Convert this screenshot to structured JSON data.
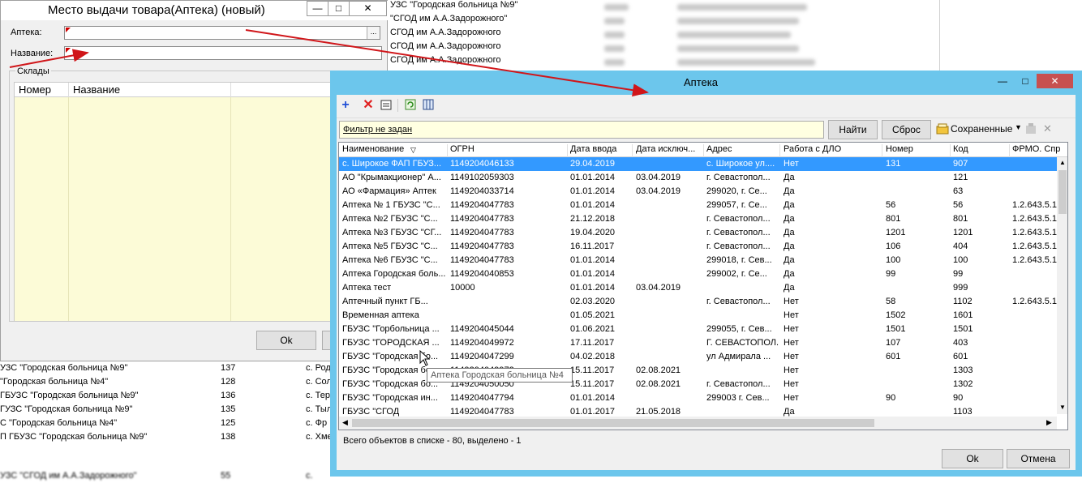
{
  "background_list_top": [
    {
      "name": "УЗС \"Городская больница №9\""
    },
    {
      "name": "\"СГОД им А.А.Задорожного\""
    },
    {
      "name": "СГОД им А.А.Задорожного"
    },
    {
      "name": "СГОД им А.А.Задорожного"
    },
    {
      "name": "СГОД им А.А.Задорожного"
    }
  ],
  "background_list_bottom": [
    {
      "name": "УЗС \"Городская больница №9\"",
      "num": "137",
      "addr": "с. Род"
    },
    {
      "name": "\"Городская больница №4\"",
      "num": "128",
      "addr": "с. Сол"
    },
    {
      "name": "ГБУЗС \"Городская больница №9\"",
      "num": "136",
      "addr": "с. Тер"
    },
    {
      "name": "ГУЗС \"Городская больница №9\"",
      "num": "135",
      "addr": "с. Тыл"
    },
    {
      "name": "С \"Городская больница №4\"",
      "num": "125",
      "addr": "с. Фр"
    },
    {
      "name": "П ГБУЗС \"Городская больница №9\"",
      "num": "138",
      "addr": "с. Хме"
    },
    {
      "name": "УЗС \"СГОД им А.А.Задорожного\"",
      "num": "55",
      "addr": "с. "
    }
  ],
  "back_dialog": {
    "title": "Место выдачи товара(Аптека) (новый)",
    "minimize": "—",
    "maximize": "□",
    "close": "✕",
    "apteka_label": "Аптека:",
    "apteka_value": "",
    "browse_label": "...",
    "name_label": "Название:",
    "name_value": "",
    "group_label": "Склады",
    "columns": [
      "Номер",
      "Название"
    ],
    "ok_label": "Ok"
  },
  "front_dialog": {
    "title": "Аптека",
    "minimize": "—",
    "maximize": "□",
    "close": "✕",
    "filter_text": "Фильтр не задан",
    "find_label": "Найти",
    "reset_label": "Сброс",
    "saved_label": "Сохраненные",
    "columns": [
      "Наименование",
      "ОГРН",
      "Дата ввода",
      "Дата исключ...",
      "Адрес",
      "Работа с ДЛО",
      "Номер",
      "Код",
      "ФРМО. Спр"
    ],
    "rows": [
      [
        "с. Широкое ФАП ГБУЗ...",
        "1149204046133",
        "29.04.2019",
        "",
        "с. Широкое ул....",
        "Нет",
        "131",
        "907",
        ""
      ],
      [
        "АО \"Крымакционер\" А...",
        "1149102059303",
        "01.01.2014",
        "03.04.2019",
        "г. Севастопол...",
        "Да",
        "",
        "121",
        ""
      ],
      [
        "АО «Фармация» Аптек",
        "1149204033714",
        "01.01.2014",
        "03.04.2019",
        "299020, г. Се...",
        "Да",
        "",
        "63",
        ""
      ],
      [
        "Аптека № 1 ГБУЗС \"С...",
        "1149204047783",
        "01.01.2014",
        "",
        "299057, г. Се...",
        "Да",
        "56",
        "56",
        "1.2.643.5.1"
      ],
      [
        "Аптека №2  ГБУЗС \"С...",
        "1149204047783",
        "21.12.2018",
        "",
        "г. Севастопол...",
        "Да",
        "801",
        "801",
        "1.2.643.5.1"
      ],
      [
        "Аптека №3 ГБУЗС \"СГ...",
        "1149204047783",
        "19.04.2020",
        "",
        "г. Севастопол...",
        "Да",
        "1201",
        "1201",
        "1.2.643.5.1"
      ],
      [
        "Аптека №5  ГБУЗС \"С...",
        "1149204047783",
        "16.11.2017",
        "",
        "г. Севастопол...",
        "Да",
        "106",
        "404",
        "1.2.643.5.1"
      ],
      [
        "Аптека №6  ГБУЗС \"С...",
        "1149204047783",
        "01.01.2014",
        "",
        "299018, г. Сев...",
        "Да",
        "100",
        "100",
        "1.2.643.5.1"
      ],
      [
        "Аптека Городская боль...",
        "1149204040853",
        "01.01.2014",
        "",
        "299002, г. Се...",
        "Да",
        "99",
        "99",
        ""
      ],
      [
        "Аптека тест",
        "10000",
        "01.01.2014",
        "03.04.2019",
        "",
        "Да",
        "",
        "999",
        ""
      ],
      [
        "Аптечный пункт ГБ...",
        "",
        "02.03.2020",
        "",
        "г. Севастопол...",
        "Нет",
        "58",
        "1102",
        "1.2.643.5.1"
      ],
      [
        "Временная аптека",
        "",
        "01.05.2021",
        "",
        "",
        "Нет",
        "1502",
        "1601",
        ""
      ],
      [
        "ГБУЗС \"Горбольница ...",
        "1149204045044",
        "01.06.2021",
        "",
        "299055, г. Сев...",
        "Нет",
        "1501",
        "1501",
        ""
      ],
      [
        "ГБУЗС \"ГОРОДСКАЯ ...",
        "1149204049972",
        "17.11.2017",
        "",
        "Г. СЕВАСТОПОЛ...",
        "Нет",
        "107",
        "403",
        ""
      ],
      [
        "ГБУЗС \"Городская бо...",
        "1149204047299",
        "04.02.2018",
        "",
        "ул Адмирала ...",
        "Нет",
        "601",
        "601",
        ""
      ],
      [
        "ГБУЗС \"Городская бо...",
        "1149204049972",
        "15.11.2017",
        "02.08.2021",
        "",
        "Нет",
        "",
        "1303",
        ""
      ],
      [
        "ГБУЗС \"Городская бо...",
        "1149204050050",
        "15.11.2017",
        "02.08.2021",
        "г. Севастопол...",
        "Нет",
        "",
        "1302",
        ""
      ],
      [
        "ГБУЗС \"Городская ин...",
        "1149204047794",
        "01.01.2014",
        "",
        "299003 г. Сев...",
        "Нет",
        "90",
        "90",
        ""
      ],
      [
        "ГБУЗС \"СГОД",
        "1149204047783",
        "01.01.2017",
        "21.05.2018",
        "",
        "Да",
        "",
        "1103",
        ""
      ]
    ],
    "tooltip": "Аптека Городская больница №4",
    "status": "Всего объектов в списке - 80, выделено - 1",
    "ok_label": "Ok",
    "cancel_label": "Отмена"
  },
  "colors": {
    "title_bar": "#6cc6ec",
    "selection": "#3399ff",
    "grid_yellow": "#fcfbd7",
    "arrow": "#d0161a"
  }
}
